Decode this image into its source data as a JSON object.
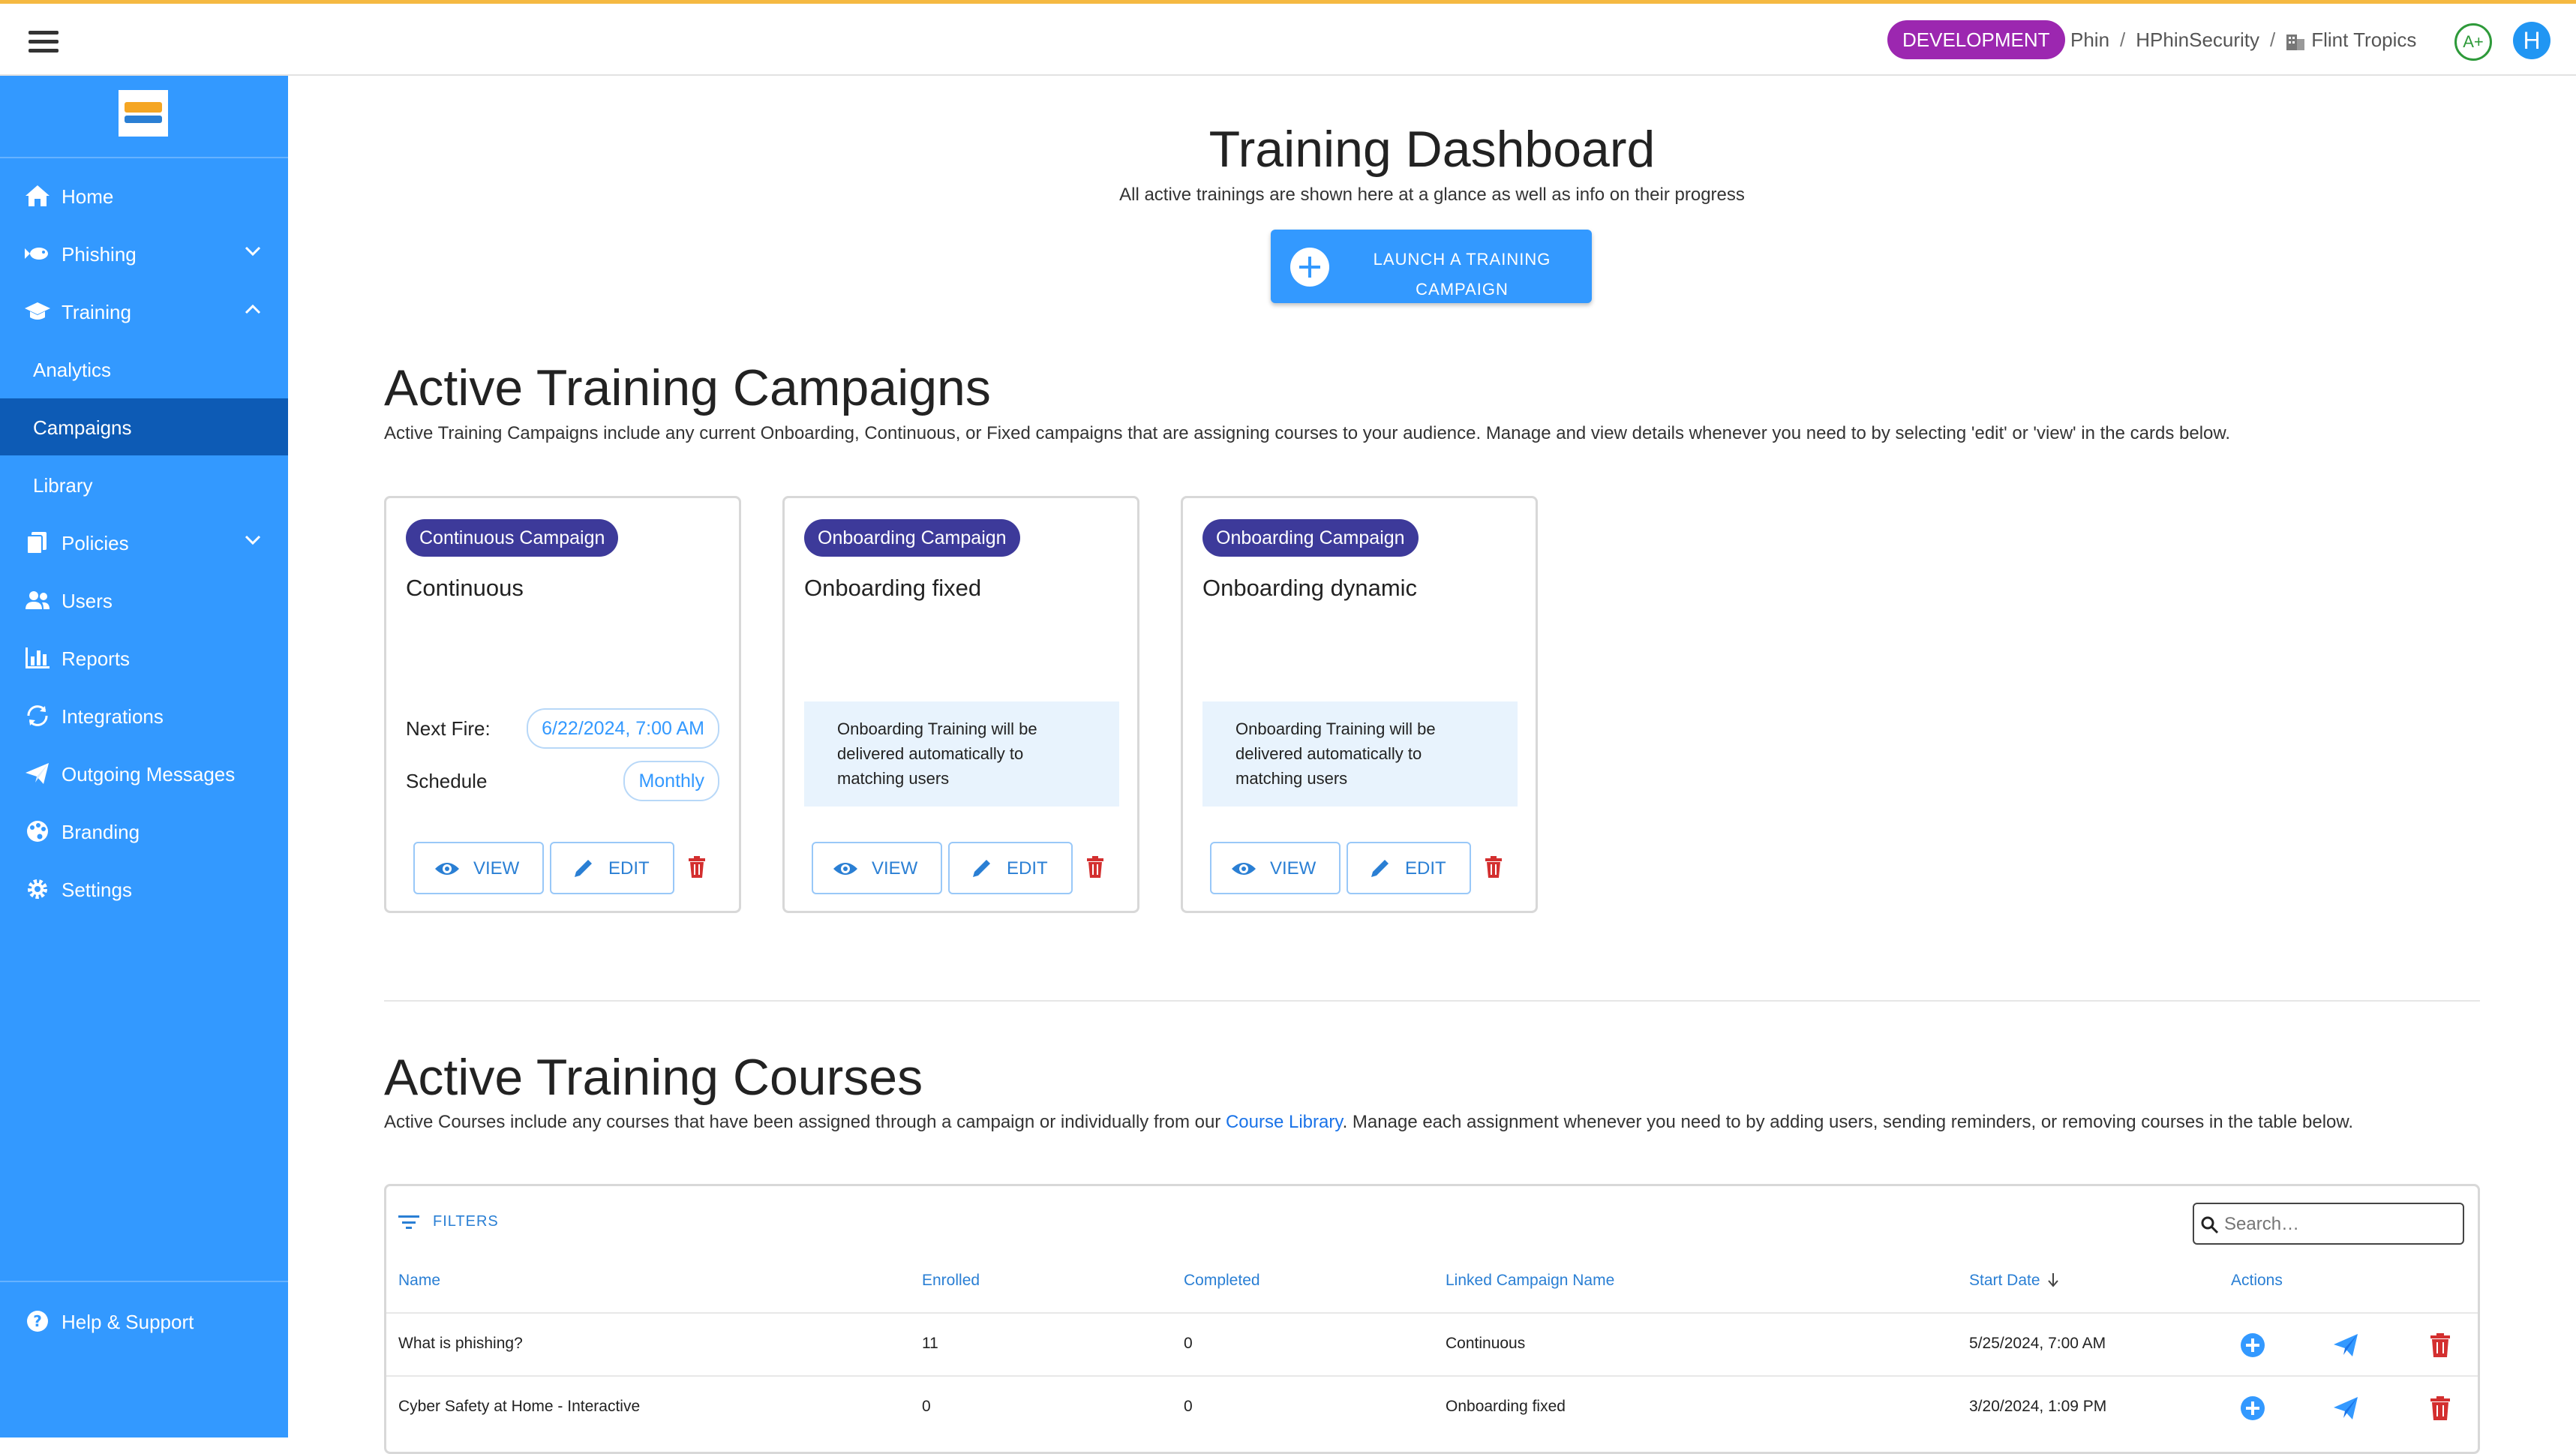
{
  "topbar": {
    "env_badge": "DEVELOPMENT",
    "breadcrumbs": [
      "Phin",
      "HPhinSecurity",
      "Flint Tropics"
    ],
    "separator": "/",
    "grade": "A+",
    "avatar_initial": "H"
  },
  "sidebar": {
    "items": [
      {
        "label": "Home",
        "icon": "home-icon"
      },
      {
        "label": "Phishing",
        "icon": "fish-icon",
        "expanded": false
      },
      {
        "label": "Training",
        "icon": "graduation-cap-icon",
        "expanded": true
      },
      {
        "label": "Analytics"
      },
      {
        "label": "Campaigns",
        "active": true
      },
      {
        "label": "Library"
      },
      {
        "label": "Policies",
        "icon": "documents-icon",
        "expanded": false
      },
      {
        "label": "Users",
        "icon": "users-icon"
      },
      {
        "label": "Reports",
        "icon": "bar-chart-icon"
      },
      {
        "label": "Integrations",
        "icon": "sync-icon"
      },
      {
        "label": "Outgoing Messages",
        "icon": "paper-plane-icon"
      },
      {
        "label": "Branding",
        "icon": "palette-icon"
      },
      {
        "label": "Settings",
        "icon": "gear-icon"
      }
    ],
    "help": {
      "label": "Help & Support",
      "icon": "help-icon"
    }
  },
  "header": {
    "title": "Training Dashboard",
    "subtitle": "All active trainings are shown here at a glance as well as info on their progress",
    "launch_line1": "LAUNCH A TRAINING",
    "launch_line2": "CAMPAIGN"
  },
  "campaigns": {
    "title": "Active Training Campaigns",
    "description": "Active Training Campaigns include any current Onboarding, Continuous, or Fixed campaigns that are assigning courses to your audience. Manage and view details whenever you need to by selecting 'edit' or 'view' in the cards below.",
    "view_label": "VIEW",
    "edit_label": "EDIT",
    "cards": [
      {
        "type": "Continuous Campaign",
        "name": "Continuous",
        "next_fire_label": "Next Fire:",
        "next_fire": "6/22/2024, 7:00 AM",
        "schedule_label": "Schedule",
        "schedule": "Monthly"
      },
      {
        "type": "Onboarding Campaign",
        "name": "Onboarding fixed",
        "notice": "Onboarding Training will be delivered automatically to matching users"
      },
      {
        "type": "Onboarding Campaign",
        "name": "Onboarding dynamic",
        "notice": "Onboarding Training will be delivered automatically to matching users"
      }
    ]
  },
  "courses": {
    "title": "Active Training Courses",
    "description_before": "Active Courses include any courses that have been assigned through a campaign or individually from our ",
    "description_link": "Course Library",
    "description_after": ". Manage each assignment whenever you need to by adding users, sending reminders, or removing courses in the table below.",
    "filters_label": "FILTERS",
    "search_placeholder": "Search…",
    "columns": [
      "Name",
      "Enrolled",
      "Completed",
      "Linked Campaign Name",
      "Start Date",
      "Actions"
    ],
    "rows": [
      {
        "name": "What is phishing?",
        "enrolled": "11",
        "completed": "0",
        "campaign": "Continuous",
        "start": "5/25/2024, 7:00 AM"
      },
      {
        "name": "Cyber Safety at Home - Interactive",
        "enrolled": "0",
        "completed": "0",
        "campaign": "Onboarding fixed",
        "start": "3/20/2024, 1:09 PM"
      }
    ]
  },
  "colors": {
    "sidebar": "#3399ff",
    "sidebar_active": "#0d5bb5",
    "chip": "#3d3a9a",
    "env_badge": "#9c27b0",
    "accent": "#2a7fd4",
    "delete": "#d32f2f"
  }
}
